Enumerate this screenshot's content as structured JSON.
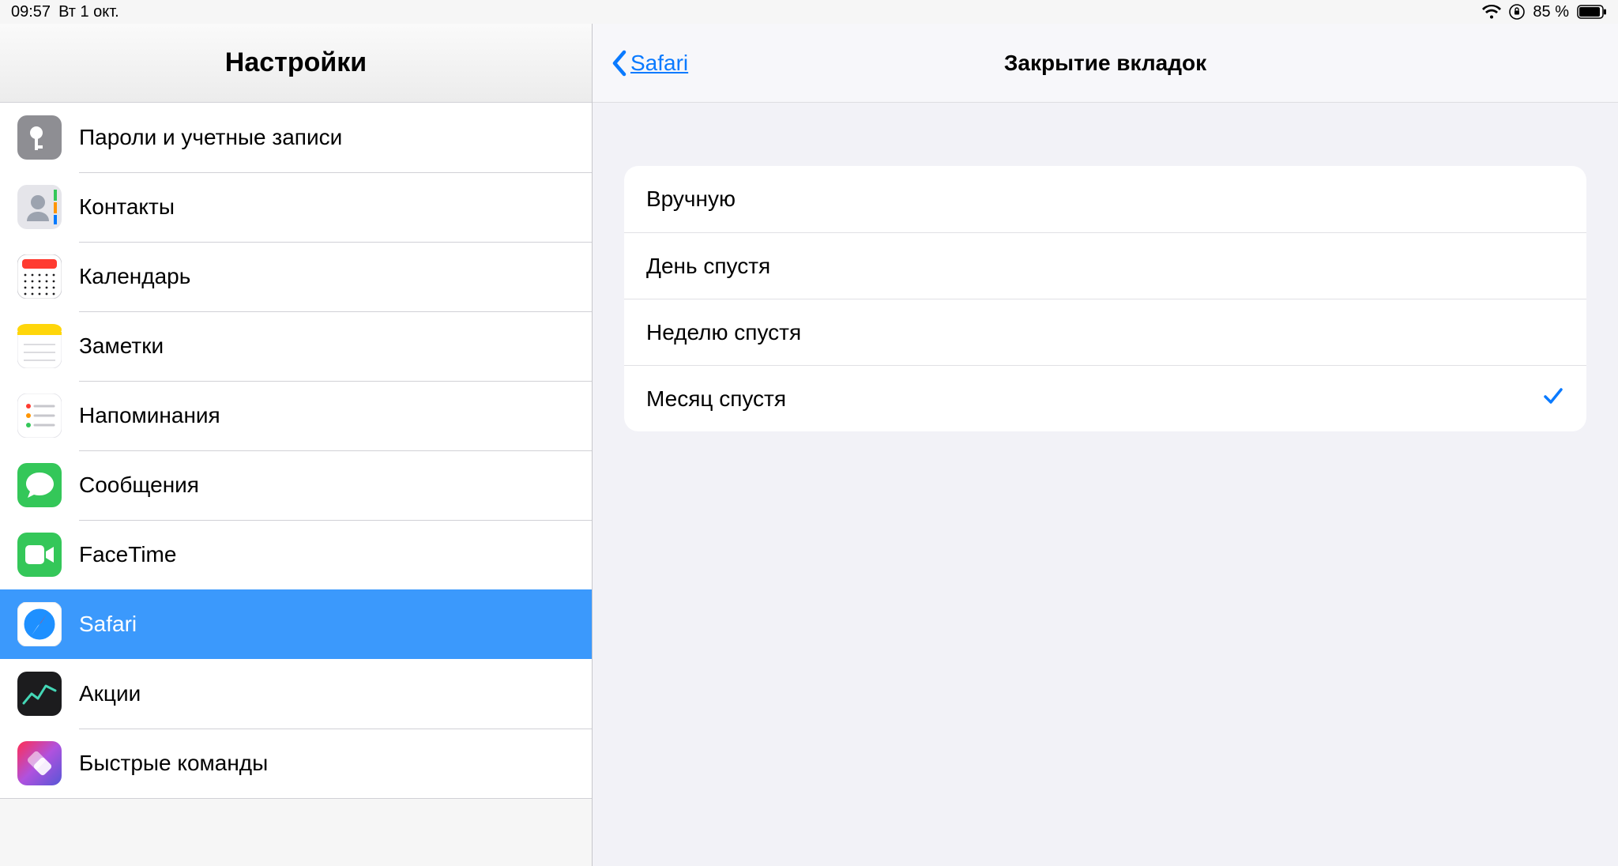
{
  "status": {
    "time": "09:57",
    "date": "Вт 1 окт.",
    "battery_pct": "85 %"
  },
  "sidebar": {
    "title": "Настройки",
    "items": [
      {
        "label": "Пароли и учетные записи",
        "slug": "passwords"
      },
      {
        "label": "Контакты",
        "slug": "contacts"
      },
      {
        "label": "Календарь",
        "slug": "calendar"
      },
      {
        "label": "Заметки",
        "slug": "notes"
      },
      {
        "label": "Напоминания",
        "slug": "reminders"
      },
      {
        "label": "Сообщения",
        "slug": "messages"
      },
      {
        "label": "FaceTime",
        "slug": "facetime"
      },
      {
        "label": "Safari",
        "slug": "safari",
        "selected": true
      },
      {
        "label": "Акции",
        "slug": "stocks"
      },
      {
        "label": "Быстрые команды",
        "slug": "shortcuts"
      }
    ]
  },
  "detail": {
    "back_label": "Safari",
    "title": "Закрытие вкладок",
    "options": [
      {
        "label": "Вручную",
        "selected": false
      },
      {
        "label": "День спустя",
        "selected": false
      },
      {
        "label": "Неделю спустя",
        "selected": false
      },
      {
        "label": "Месяц спустя",
        "selected": true
      }
    ]
  }
}
